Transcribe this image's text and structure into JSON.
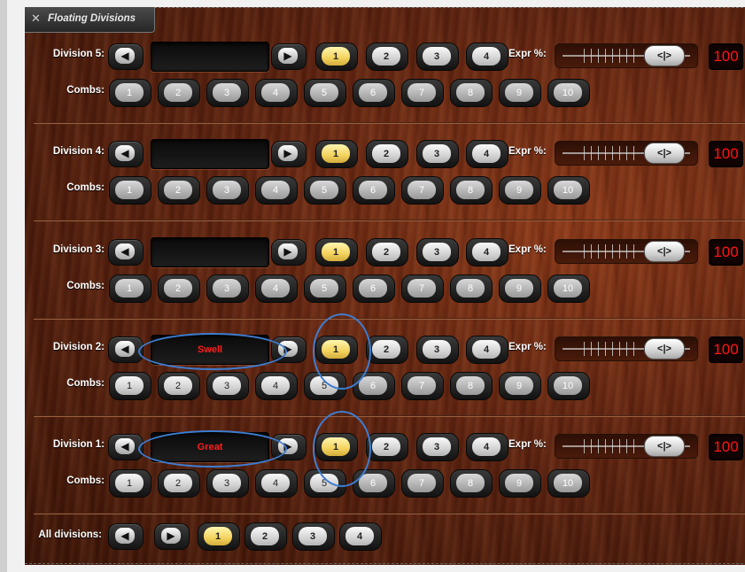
{
  "window": {
    "title": "Floating Divisions",
    "close_icon": "✕"
  },
  "divisions": [
    {
      "label": "Division 5:",
      "display": "",
      "selected": "1"
    },
    {
      "label": "Division 4:",
      "display": "",
      "selected": "1"
    },
    {
      "label": "Division 3:",
      "display": "",
      "selected": "1"
    },
    {
      "label": "Division 2:",
      "display": "Swell",
      "selected": "1"
    },
    {
      "label": "Division 1:",
      "display": "Great",
      "selected": "1"
    }
  ],
  "banks": [
    "1",
    "2",
    "3",
    "4"
  ],
  "combs_label": "Combs:",
  "combs": [
    "1",
    "2",
    "3",
    "4",
    "5",
    "6",
    "7",
    "8",
    "9",
    "10"
  ],
  "expr": {
    "label": "Expr %:",
    "value": "100",
    "knob_label": "<|>"
  },
  "all_divisions": {
    "label": "All divisions:",
    "banks": [
      "1",
      "2",
      "3",
      "4"
    ],
    "selected": "1"
  },
  "colors": {
    "selected_yellow": "#f3d35e",
    "red_display": "#ff1d1d",
    "annotation_blue": "#3e7dd1"
  },
  "annotations": "blue-ellipses around Swell/Great displays and bank-1 buttons on divisions 2 and 1"
}
